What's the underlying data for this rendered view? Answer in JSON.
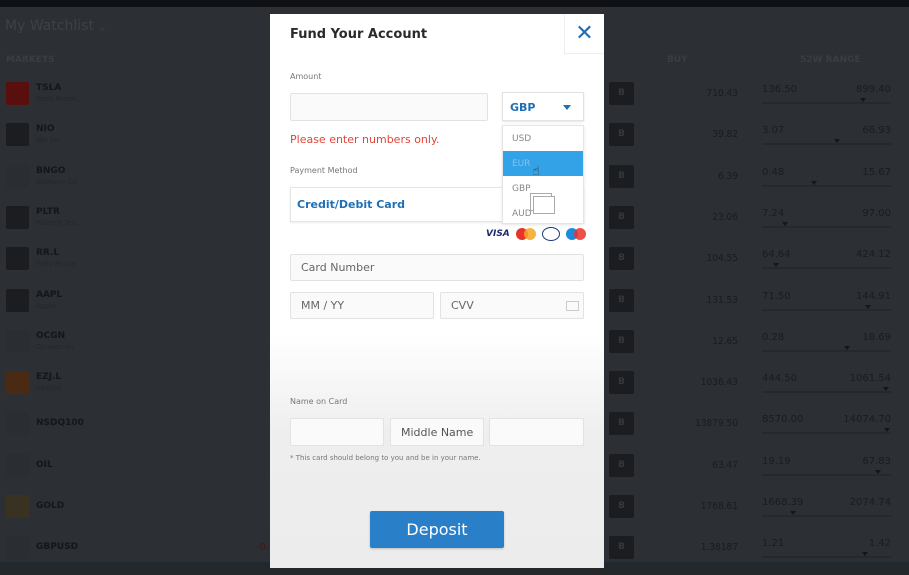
{
  "watchlist": {
    "title": "My Watchlist",
    "chevron": "chevron-down-icon"
  },
  "columns": {
    "markets": "MARKETS",
    "buy": "BUY",
    "range": "52W RANGE"
  },
  "buy_button_label": "B",
  "markets": [
    {
      "symbol": "TSLA",
      "name": "Tesla Motor...",
      "buy": "710.43",
      "low": "136.50",
      "high": "899.40",
      "pos": 0.78,
      "logo_color": "#5a0f0f"
    },
    {
      "symbol": "NIO",
      "name": "Nio Inc.",
      "buy": "39.82",
      "low": "3.07",
      "high": "66.93",
      "pos": 0.58,
      "logo_color": "#1b1d20"
    },
    {
      "symbol": "BNGO",
      "name": "BioNano Ge...",
      "buy": "6.39",
      "low": "0.48",
      "high": "15.67",
      "pos": 0.4,
      "logo_color": "#2a2d31"
    },
    {
      "symbol": "PLTR",
      "name": "Palantir Tec...",
      "buy": "23.06",
      "low": "7.24",
      "high": "97.00",
      "pos": 0.18,
      "logo_color": "#1b1d20"
    },
    {
      "symbol": "RR.L",
      "name": "Rolls-Royce",
      "buy": "104.55",
      "low": "64.64",
      "high": "424.12",
      "pos": 0.11,
      "logo_color": "#1b1d20"
    },
    {
      "symbol": "AAPL",
      "name": "Apple",
      "buy": "131.53",
      "low": "71.50",
      "high": "144.91",
      "pos": 0.82,
      "logo_color": "#1b1d20"
    },
    {
      "symbol": "OCGN",
      "name": "Ocugen Inc",
      "buy": "12.65",
      "low": "0.28",
      "high": "18.69",
      "pos": 0.66,
      "logo_color": "#2a2d31"
    },
    {
      "symbol": "EZJ.L",
      "name": "easyJet",
      "buy": "1036.43",
      "low": "444.50",
      "high": "1061.54",
      "pos": 0.96,
      "logo_color": "#4a2a12"
    },
    {
      "symbol": "NSDQ100",
      "name": "",
      "buy": "13879.50",
      "low": "8570.00",
      "high": "14074.70",
      "pos": 0.97,
      "logo_color": "#2a2d31"
    },
    {
      "symbol": "OIL",
      "name": "",
      "buy": "63.47",
      "low": "19.19",
      "high": "67.83",
      "pos": 0.9,
      "logo_color": "#2a2d31"
    },
    {
      "symbol": "GOLD",
      "name": "",
      "buy": "1768.61",
      "low": "1668.39",
      "high": "2074.74",
      "pos": 0.24,
      "logo_color": "#3a3220"
    },
    {
      "symbol": "GBPUSD",
      "name": "",
      "buy": "1.38187",
      "low": "1.21",
      "high": "1.42",
      "pos": 0.8,
      "logo_color": "#2a2d31",
      "change": "-0."
    }
  ],
  "modal": {
    "title": "Fund Your Account",
    "close_icon": "close-icon",
    "amount_label": "Amount",
    "amount_value": "",
    "currency_selected": "GBP",
    "currency_options": [
      "USD",
      "EUR",
      "GBP",
      "AUD"
    ],
    "currency_highlighted": "EUR",
    "error": "Please enter numbers only.",
    "payment_label": "Payment Method",
    "payment_method": "Credit/Debit Card",
    "card_brands": [
      "VISA",
      "Mastercard",
      "Diners Club",
      "Maestro"
    ],
    "card_number_placeholder": "Card Number",
    "expiry_placeholder": "MM / YY",
    "cvv_placeholder": "CVV",
    "name_label": "Name on Card",
    "middle_name_placeholder": "Middle Name",
    "note": "* This card should belong to you and be in your name.",
    "deposit_label": "Deposit"
  },
  "colors": {
    "accent": "#1f6fb5",
    "error": "#e0453a",
    "highlight": "#34a2e6",
    "deposit": "#2a7fc9"
  }
}
